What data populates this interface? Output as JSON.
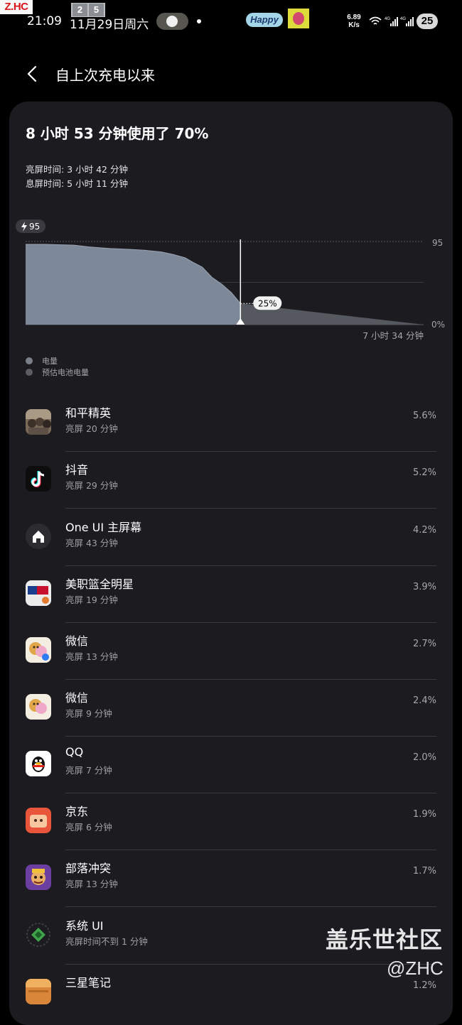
{
  "status_bar": {
    "watermark_corner": "Z.HC",
    "watermark_digits": [
      "2",
      "5"
    ],
    "time": "21:09",
    "date": "11月29日周六",
    "happy_sticker": "Happy",
    "net_speed_value": "6.89",
    "net_speed_unit": "K/s",
    "wifi_icon": "wifi-icon",
    "sim_labels": [
      "4G",
      "4G"
    ],
    "battery_level": "25"
  },
  "header": {
    "back_icon": "back-chevron-icon",
    "title": "自上次充电以来"
  },
  "summary": {
    "headline": "8 小时 53 分钟使用了 70%",
    "screen_on": "亮屏时间: 3 小时 42 分钟",
    "screen_off": "息屏时间: 5 小时 11 分钟"
  },
  "chart_data": {
    "type": "area",
    "start_badge": "95",
    "current_badge": "25%",
    "y_top_label": "95",
    "y_bottom_label": "0%",
    "remaining_label": "7 小时 34 分钟",
    "ylim": [
      0,
      100
    ],
    "xlim_hours": [
      0,
      16.45
    ],
    "current_hour": 8.88,
    "series": [
      {
        "name": "电量",
        "color": "#7d8899",
        "x": [
          0,
          0.8,
          2.0,
          2.6,
          3.5,
          4.35,
          4.9,
          5.6,
          6.1,
          6.6,
          6.9,
          7.3,
          7.7,
          8.1,
          8.5,
          8.88
        ],
        "y": [
          95,
          95,
          94,
          92,
          90,
          89,
          88,
          86,
          83,
          79,
          74,
          68,
          56,
          48,
          38,
          25
        ]
      },
      {
        "name": "预估电池电量",
        "color": "#56585f",
        "x": [
          8.88,
          16.45
        ],
        "y": [
          25,
          0
        ]
      }
    ]
  },
  "legend": [
    {
      "label": "电量",
      "color": "#7a7f89"
    },
    {
      "label": "预估电池电量",
      "color": "#5b5d63"
    }
  ],
  "apps": [
    {
      "name": "和平精英",
      "sub": "亮屏 20 分钟",
      "pct": "5.6%",
      "icon": "peace-elite-game-icon"
    },
    {
      "name": "抖音",
      "sub": "亮屏 29 分钟",
      "pct": "5.2%",
      "icon": "douyin-icon"
    },
    {
      "name": "One UI 主屏幕",
      "sub": "亮屏 43 分钟",
      "pct": "4.2%",
      "icon": "home-icon"
    },
    {
      "name": "美职篮全明星",
      "sub": "亮屏 19 分钟",
      "pct": "3.9%",
      "icon": "nba-allstar-icon"
    },
    {
      "name": "微信",
      "sub": "亮屏 13 分钟",
      "pct": "2.7%",
      "icon": "wechat-icon"
    },
    {
      "name": "微信",
      "sub": "亮屏 9 分钟",
      "pct": "2.4%",
      "icon": "wechat-icon"
    },
    {
      "name": "QQ",
      "sub": "亮屏 7 分钟",
      "pct": "2.0%",
      "icon": "qq-penguin-icon"
    },
    {
      "name": "京东",
      "sub": "亮屏 6 分钟",
      "pct": "1.9%",
      "icon": "jd-icon"
    },
    {
      "name": "部落冲突",
      "sub": "亮屏 13 分钟",
      "pct": "1.7%",
      "icon": "clash-of-clans-icon"
    },
    {
      "name": "系统 UI",
      "sub": "亮屏时间不到 1 分钟",
      "pct": "",
      "icon": "system-ui-icon"
    },
    {
      "name": "三星笔记",
      "sub": "",
      "pct": "1.2%",
      "icon": "samsung-notes-icon"
    }
  ],
  "watermark": {
    "text": "盖乐世社区",
    "sub": "@ZHC"
  }
}
